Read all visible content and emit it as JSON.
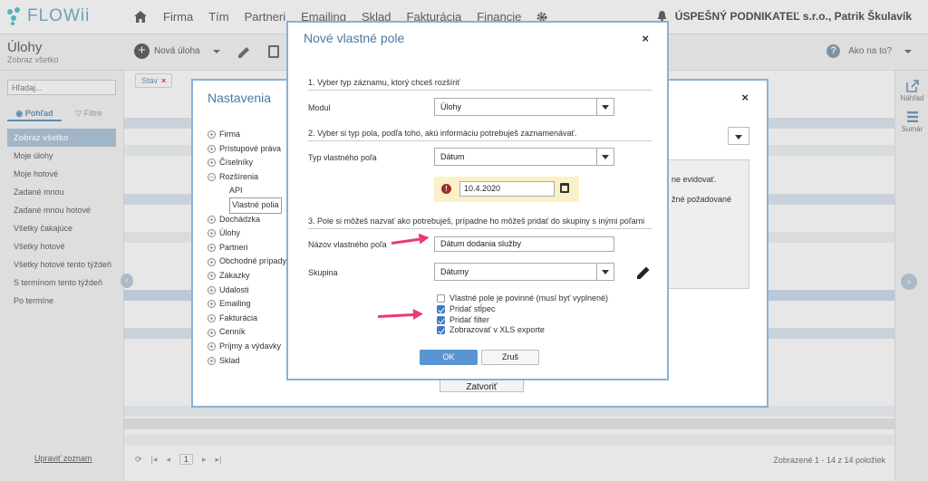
{
  "app": {
    "logo": "FLOWii"
  },
  "nav": {
    "items": [
      "Firma",
      "Tím",
      "Partneri",
      "Emailing",
      "Sklad",
      "Fakturácia",
      "Financie"
    ]
  },
  "company": "ÚSPEŠNÝ PODNIKATEĽ s.r.o., Patrik Škulavík",
  "page": {
    "title": "Úlohy",
    "subtitle": "Zobraz všetko"
  },
  "toolbar": {
    "new_task": "Nová úloha"
  },
  "help": "Ako na to?",
  "sidebar": {
    "search_placeholder": "Hľadaj...",
    "tab_view": "Pohľad",
    "tab_filters": "Filtre",
    "items": [
      "Zobraz všetko",
      "Moje úlohy",
      "Moje hotové",
      "Zadané mnou",
      "Zadané mnou hotové",
      "Všetky čakajúce",
      "Všetky hotové",
      "Všetky hotové tento týždeň",
      "S termínom tento týždeň",
      "Po termíne"
    ],
    "edit_list": "Upraviť zoznam"
  },
  "filter_chip": "Stav",
  "footer": {
    "page": "1",
    "count": "Zobrazené 1 - 14 z 14 položiek"
  },
  "rail": {
    "preview": "Náhľad",
    "summary": "Sumár"
  },
  "settings": {
    "title": "Nastavenia",
    "tree": [
      {
        "label": "Firma",
        "type": "node"
      },
      {
        "label": "Prístupové práva",
        "type": "node"
      },
      {
        "label": "Číselníky",
        "type": "node"
      },
      {
        "label": "Rozšírenia",
        "type": "open"
      },
      {
        "label": "API",
        "type": "sub"
      },
      {
        "label": "Vlastné polia",
        "type": "sub-selected"
      },
      {
        "label": "Dochádzka",
        "type": "node"
      },
      {
        "label": "Úlohy",
        "type": "node"
      },
      {
        "label": "Partneri",
        "type": "node"
      },
      {
        "label": "Obchodné prípady",
        "type": "node"
      },
      {
        "label": "Zákazky",
        "type": "node"
      },
      {
        "label": "Udalosti",
        "type": "node"
      },
      {
        "label": "Emailing",
        "type": "node"
      },
      {
        "label": "Fakturácia",
        "type": "node"
      },
      {
        "label": "Cenník",
        "type": "node"
      },
      {
        "label": "Príjmy a výdavky",
        "type": "node"
      },
      {
        "label": "Sklad",
        "type": "node"
      }
    ],
    "info_line1": "ne evidovať.",
    "info_line2": "žné požadované",
    "close_button": "Zatvoriť"
  },
  "dialog": {
    "title": "Nové vlastné pole",
    "step1": "1. Vyber typ záznamu, ktorý chceš rozšíriť",
    "module_label": "Modul",
    "module_value": "Úlohy",
    "step2": "2. Vyber si typ pola, podľa toho, akú informáciu potrebuješ zaznamenávať.",
    "type_label": "Typ vlastného poľa",
    "type_value": "Dátum",
    "date_value": "10.4.2020",
    "step3": "3. Pole si môžeš nazvať ako potrebuješ, prípadne ho môžeš pridať do skupiny s inými poľami",
    "name_label": "Názov vlastného poľa",
    "name_value": "Dátum dodania služby",
    "group_label": "Skupina",
    "group_value": "Dátumy",
    "checkboxes": [
      {
        "label": "Vlastné pole je povinné (musí byť vyplnené)",
        "checked": false
      },
      {
        "label": "Pridať stĺpec",
        "checked": true
      },
      {
        "label": "Pridať filter",
        "checked": true
      },
      {
        "label": "Zobrazovať v XLS exporte",
        "checked": true
      }
    ],
    "ok": "OK",
    "cancel": "Zruš"
  },
  "colors": {
    "accent": "#5a95d3",
    "arrow": "#ec3a74",
    "dialog_border": "#8ab0d4"
  }
}
